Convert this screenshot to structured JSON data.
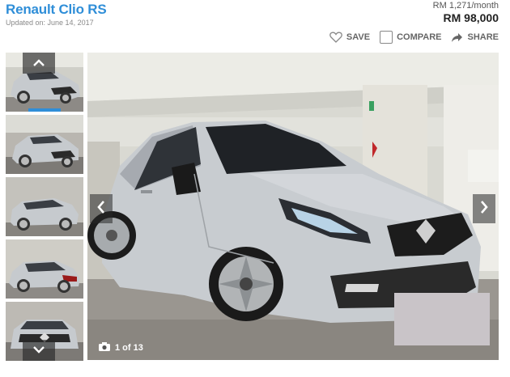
{
  "listing": {
    "title": "Renault Clio RS",
    "updated": "Updated on: June 14, 2017",
    "monthly": "RM 1,271/month",
    "price": "RM 98,000"
  },
  "actions": {
    "save": "SAVE",
    "compare": "COMPARE",
    "share": "SHARE"
  },
  "gallery": {
    "counter": "1 of 13",
    "thumbnails": [
      "thumb-1",
      "thumb-2",
      "thumb-3",
      "thumb-4",
      "thumb-5"
    ],
    "active_index": 0
  },
  "icons": {
    "save": "heart-outline-icon",
    "compare": "checkbox-icon",
    "share": "share-arrow-icon",
    "camera": "camera-icon",
    "prev": "chevron-left-icon",
    "next": "chevron-right-icon",
    "thumb_up": "chevron-up-icon",
    "thumb_down": "chevron-down-icon"
  },
  "colors": {
    "title": "#2f8ed8",
    "accent": "#2f8ed8",
    "car_body": "#c8ccd0"
  }
}
